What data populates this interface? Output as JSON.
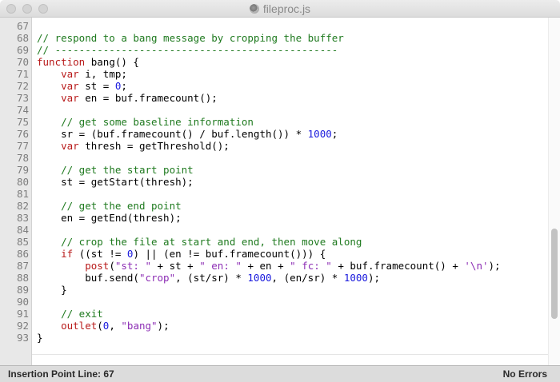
{
  "window": {
    "title": "fileproc.js",
    "icon": "document-icon"
  },
  "editor": {
    "lines": [
      {
        "num": "67",
        "tokens": []
      },
      {
        "num": "68",
        "tokens": [
          {
            "t": "// respond to a bang message by cropping the buffer",
            "c": "c"
          }
        ]
      },
      {
        "num": "69",
        "tokens": [
          {
            "t": "// -----------------------------------------------",
            "c": "c"
          }
        ]
      },
      {
        "num": "70",
        "tokens": [
          {
            "t": "function",
            "c": "k"
          },
          {
            "t": " bang() {",
            "c": "t"
          }
        ]
      },
      {
        "num": "71",
        "tokens": [
          {
            "t": "    ",
            "c": "t"
          },
          {
            "t": "var",
            "c": "k"
          },
          {
            "t": " i, tmp;",
            "c": "t"
          }
        ]
      },
      {
        "num": "72",
        "tokens": [
          {
            "t": "    ",
            "c": "t"
          },
          {
            "t": "var",
            "c": "k"
          },
          {
            "t": " st = ",
            "c": "t"
          },
          {
            "t": "0",
            "c": "n"
          },
          {
            "t": ";",
            "c": "t"
          }
        ]
      },
      {
        "num": "73",
        "tokens": [
          {
            "t": "    ",
            "c": "t"
          },
          {
            "t": "var",
            "c": "k"
          },
          {
            "t": " en = buf.framecount();",
            "c": "t"
          }
        ]
      },
      {
        "num": "74",
        "tokens": []
      },
      {
        "num": "75",
        "tokens": [
          {
            "t": "    ",
            "c": "t"
          },
          {
            "t": "// get some baseline information",
            "c": "c"
          }
        ]
      },
      {
        "num": "76",
        "tokens": [
          {
            "t": "    sr = (buf.framecount() / buf.length()) * ",
            "c": "t"
          },
          {
            "t": "1000",
            "c": "n"
          },
          {
            "t": ";",
            "c": "t"
          }
        ]
      },
      {
        "num": "77",
        "tokens": [
          {
            "t": "    ",
            "c": "t"
          },
          {
            "t": "var",
            "c": "k"
          },
          {
            "t": " thresh = getThreshold();",
            "c": "t"
          }
        ]
      },
      {
        "num": "78",
        "tokens": []
      },
      {
        "num": "79",
        "tokens": [
          {
            "t": "    ",
            "c": "t"
          },
          {
            "t": "// get the start point",
            "c": "c"
          }
        ]
      },
      {
        "num": "80",
        "tokens": [
          {
            "t": "    st = getStart(thresh);",
            "c": "t"
          }
        ]
      },
      {
        "num": "81",
        "tokens": []
      },
      {
        "num": "82",
        "tokens": [
          {
            "t": "    ",
            "c": "t"
          },
          {
            "t": "// get the end point",
            "c": "c"
          }
        ]
      },
      {
        "num": "83",
        "tokens": [
          {
            "t": "    en = getEnd(thresh);",
            "c": "t"
          }
        ]
      },
      {
        "num": "84",
        "tokens": []
      },
      {
        "num": "85",
        "tokens": [
          {
            "t": "    ",
            "c": "t"
          },
          {
            "t": "// crop the file at start and end, then move along",
            "c": "c"
          }
        ]
      },
      {
        "num": "86",
        "tokens": [
          {
            "t": "    ",
            "c": "t"
          },
          {
            "t": "if",
            "c": "k"
          },
          {
            "t": " ((st != ",
            "c": "t"
          },
          {
            "t": "0",
            "c": "n"
          },
          {
            "t": ") || (en != buf.framecount())) {",
            "c": "t"
          }
        ]
      },
      {
        "num": "87",
        "tokens": [
          {
            "t": "        ",
            "c": "t"
          },
          {
            "t": "post",
            "c": "k"
          },
          {
            "t": "(",
            "c": "t"
          },
          {
            "t": "\"st: \"",
            "c": "s"
          },
          {
            "t": " + st + ",
            "c": "t"
          },
          {
            "t": "\" en: \"",
            "c": "s"
          },
          {
            "t": " + en + ",
            "c": "t"
          },
          {
            "t": "\" fc: \"",
            "c": "s"
          },
          {
            "t": " + buf.framecount() + ",
            "c": "t"
          },
          {
            "t": "'\\n'",
            "c": "s"
          },
          {
            "t": ");",
            "c": "t"
          }
        ]
      },
      {
        "num": "88",
        "tokens": [
          {
            "t": "        buf.send(",
            "c": "t"
          },
          {
            "t": "\"crop\"",
            "c": "s"
          },
          {
            "t": ", (st/sr) * ",
            "c": "t"
          },
          {
            "t": "1000",
            "c": "n"
          },
          {
            "t": ", (en/sr) * ",
            "c": "t"
          },
          {
            "t": "1000",
            "c": "n"
          },
          {
            "t": ");",
            "c": "t"
          }
        ]
      },
      {
        "num": "89",
        "tokens": [
          {
            "t": "    }",
            "c": "t"
          }
        ]
      },
      {
        "num": "90",
        "tokens": []
      },
      {
        "num": "91",
        "tokens": [
          {
            "t": "    ",
            "c": "t"
          },
          {
            "t": "// exit",
            "c": "c"
          }
        ]
      },
      {
        "num": "92",
        "tokens": [
          {
            "t": "    ",
            "c": "t"
          },
          {
            "t": "outlet",
            "c": "k"
          },
          {
            "t": "(",
            "c": "t"
          },
          {
            "t": "0",
            "c": "n"
          },
          {
            "t": ", ",
            "c": "t"
          },
          {
            "t": "\"bang\"",
            "c": "s"
          },
          {
            "t": ");",
            "c": "t"
          }
        ]
      },
      {
        "num": "93",
        "tokens": [
          {
            "t": "}",
            "c": "t"
          }
        ]
      }
    ]
  },
  "scrollbar": {
    "position": 0.82,
    "visible_fraction": 0.26
  },
  "status": {
    "left": "Insertion Point Line: 67",
    "right": "No Errors"
  }
}
